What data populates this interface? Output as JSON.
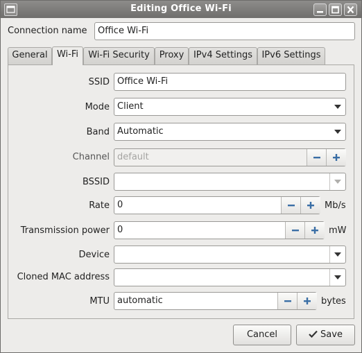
{
  "window": {
    "title": "Editing Office Wi-Fi",
    "connection_name_label": "Connection name",
    "connection_name_value": "Office Wi-Fi"
  },
  "tabs": [
    {
      "label": "General",
      "active": false
    },
    {
      "label": "Wi-Fi",
      "active": true
    },
    {
      "label": "Wi-Fi Security",
      "active": false
    },
    {
      "label": "Proxy",
      "active": false
    },
    {
      "label": "IPv4 Settings",
      "active": false
    },
    {
      "label": "IPv6 Settings",
      "active": false
    }
  ],
  "wifi": {
    "ssid_label": "SSID",
    "ssid_value": "Office Wi-Fi",
    "mode_label": "Mode",
    "mode_value": "Client",
    "band_label": "Band",
    "band_value": "Automatic",
    "channel_label": "Channel",
    "channel_placeholder": "default",
    "bssid_label": "BSSID",
    "bssid_value": "",
    "rate_label": "Rate",
    "rate_value": "0",
    "rate_unit": "Mb/s",
    "tx_power_label": "Transmission power",
    "tx_power_value": "0",
    "tx_power_unit": "mW",
    "device_label": "Device",
    "device_value": "",
    "cloned_mac_label": "Cloned MAC address",
    "cloned_mac_value": "",
    "mtu_label": "MTU",
    "mtu_value": "automatic",
    "mtu_unit": "bytes"
  },
  "buttons": {
    "cancel": "Cancel",
    "save": "Save"
  },
  "icons": {
    "window_icon": "app-window-icon",
    "minimize": "minimize-icon",
    "maximize": "maximize-icon",
    "close": "close-icon",
    "save": "checkmark-icon"
  }
}
